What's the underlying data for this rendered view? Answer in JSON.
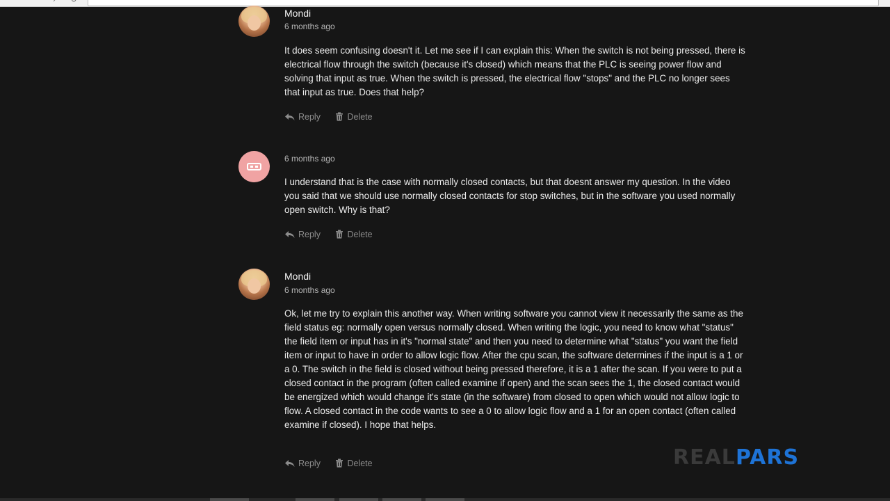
{
  "comments": [
    {
      "author": "Mondi",
      "avatar": "photo",
      "timestamp": "6 months ago",
      "body": "It does seem confusing doesn't it. Let me see if I can explain this: When the switch is not being pressed, there is electrical flow through the switch (because it's closed) which means that the PLC is seeing power flow and solving that input as true. When the switch is pressed, the electrical flow \"stops\" and the PLC no longer sees that input as true. Does that help?",
      "reply_label": "Reply",
      "delete_label": "Delete"
    },
    {
      "author": "",
      "avatar": "default",
      "timestamp": "6 months ago",
      "body": "I understand that is the case with normally closed contacts, but that doesnt answer my question. In the video you said that we should use normally closed contacts for stop switches, but in the software you used normally open switch. Why is that?",
      "reply_label": "Reply",
      "delete_label": "Delete"
    },
    {
      "author": "Mondi",
      "avatar": "photo",
      "timestamp": "6 months ago",
      "body": "Ok, let me try to explain this another way. When writing software you cannot view it necessarily the same as the field status eg: normally open versus normally closed. When writing the logic, you need to know what \"status\" the field item or input has in it's \"normal state\" and then you need to determine what \"status\" you want the field item or input to have in order to allow logic flow. After the cpu scan, the software determines if the input is a 1 or a 0. The switch in the field is closed without being pressed therefore, it is a 1 after the scan. If you were to put a closed contact in the program (often called examine if open) and the scan sees the 1, the closed contact would be energized which would change it's state (in the software) from closed to open which would not allow logic to flow. A closed contact in the code wants to see a 0 to allow logic flow and a 1 for an open contact (often called examine if closed). I hope that helps.",
      "reply_label": "Reply",
      "delete_label": "Delete"
    }
  ],
  "watermark": {
    "part1": "REAL",
    "part2": "PARS"
  },
  "colors": {
    "background": "#161616",
    "text": "#ececec",
    "muted": "#8c8c8c",
    "default_avatar": "#f0a3a3",
    "brand_blue": "#1e73d6"
  }
}
